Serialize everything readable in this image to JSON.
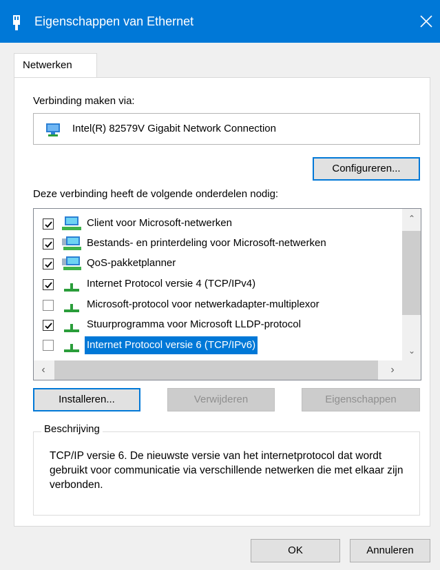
{
  "window": {
    "title": "Eigenschappen van Ethernet",
    "icon": "ethernet-port-icon",
    "close_icon": "close-icon"
  },
  "tabs": [
    {
      "label": "Netwerken",
      "active": true
    }
  ],
  "connection": {
    "label": "Verbinding maken via:",
    "adapter_name": "Intel(R) 82579V Gigabit Network Connection",
    "adapter_icon": "network-adapter-icon",
    "configure_label": "Configureren..."
  },
  "components": {
    "label": "Deze verbinding heeft de volgende onderdelen nodig:",
    "items": [
      {
        "label": "Client voor Microsoft-netwerken",
        "checked": true,
        "icon": "network-client-icon",
        "selected": false
      },
      {
        "label": "Bestands- en printerdeling voor Microsoft-netwerken",
        "checked": true,
        "icon": "network-service-icon",
        "selected": false
      },
      {
        "label": "QoS-pakketplanner",
        "checked": true,
        "icon": "network-service-icon",
        "selected": false
      },
      {
        "label": "Internet Protocol versie 4 (TCP/IPv4)",
        "checked": true,
        "icon": "protocol-icon",
        "selected": false
      },
      {
        "label": "Microsoft-protocol voor netwerkadapter-multiplexor",
        "checked": false,
        "icon": "protocol-icon",
        "selected": false
      },
      {
        "label": "Stuurprogramma voor Microsoft LLDP-protocol",
        "checked": true,
        "icon": "protocol-icon",
        "selected": false
      },
      {
        "label": "Internet Protocol versie 6 (TCP/IPv6)",
        "checked": false,
        "icon": "protocol-icon",
        "selected": true
      }
    ]
  },
  "buttons": {
    "install": "Installeren...",
    "remove": "Verwijderen",
    "properties": "Eigenschappen",
    "ok": "OK",
    "cancel": "Annuleren"
  },
  "description": {
    "title": "Beschrijving",
    "text": "TCP/IP versie 6. De nieuwste versie van het internetprotocol dat wordt gebruikt voor communicatie via verschillende netwerken die met elkaar zijn verbonden."
  },
  "colors": {
    "accent": "#0078d7",
    "selection": "#0078d7",
    "protocol_green": "#2a9d3a"
  }
}
